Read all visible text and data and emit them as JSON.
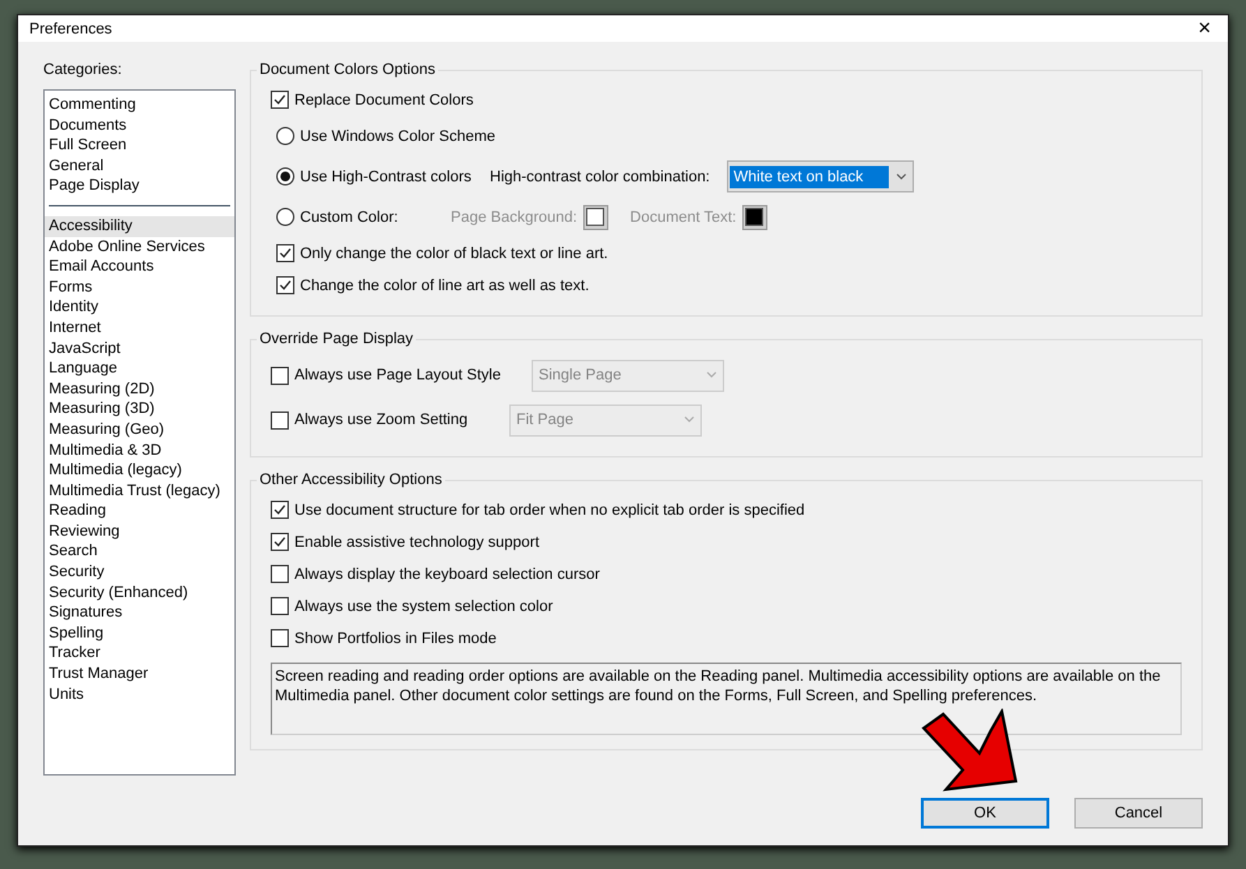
{
  "window": {
    "title": "Preferences",
    "close": "×"
  },
  "categories": {
    "label": "Categories:",
    "top_items": [
      {
        "label": "Commenting",
        "selected": false
      },
      {
        "label": "Documents",
        "selected": false
      },
      {
        "label": "Full Screen",
        "selected": false
      },
      {
        "label": "General",
        "selected": false
      },
      {
        "label": "Page Display",
        "selected": false
      }
    ],
    "items": [
      {
        "label": "Accessibility",
        "selected": true
      },
      {
        "label": "Adobe Online Services",
        "selected": false
      },
      {
        "label": "Email Accounts",
        "selected": false
      },
      {
        "label": "Forms",
        "selected": false
      },
      {
        "label": "Identity",
        "selected": false
      },
      {
        "label": "Internet",
        "selected": false
      },
      {
        "label": "JavaScript",
        "selected": false
      },
      {
        "label": "Language",
        "selected": false
      },
      {
        "label": "Measuring (2D)",
        "selected": false
      },
      {
        "label": "Measuring (3D)",
        "selected": false
      },
      {
        "label": "Measuring (Geo)",
        "selected": false
      },
      {
        "label": "Multimedia & 3D",
        "selected": false
      },
      {
        "label": "Multimedia (legacy)",
        "selected": false
      },
      {
        "label": "Multimedia Trust (legacy)",
        "selected": false
      },
      {
        "label": "Reading",
        "selected": false
      },
      {
        "label": "Reviewing",
        "selected": false
      },
      {
        "label": "Search",
        "selected": false
      },
      {
        "label": "Security",
        "selected": false
      },
      {
        "label": "Security (Enhanced)",
        "selected": false
      },
      {
        "label": "Signatures",
        "selected": false
      },
      {
        "label": "Spelling",
        "selected": false
      },
      {
        "label": "Tracker",
        "selected": false
      },
      {
        "label": "Trust Manager",
        "selected": false
      },
      {
        "label": "Units",
        "selected": false
      }
    ]
  },
  "document_colors": {
    "title": "Document Colors Options",
    "replace": {
      "label": "Replace Document Colors",
      "checked": true
    },
    "radios": [
      {
        "label": "Use Windows Color Scheme",
        "selected": false
      },
      {
        "label": "Use High-Contrast colors",
        "selected": true,
        "extra_label": "High-contrast color combination:",
        "dropdown": {
          "value": "White text on black",
          "focused": true
        }
      },
      {
        "label": "Custom Color:",
        "selected": false,
        "swatches": [
          {
            "label": "Page Background:",
            "color": "#ffffff"
          },
          {
            "label": "Document Text:",
            "color": "#000000"
          }
        ]
      }
    ],
    "checks": [
      {
        "label": "Only change the color of black text or line art.",
        "checked": true
      },
      {
        "label": "Change the color of line art as well as text.",
        "checked": true
      }
    ]
  },
  "override_page_display": {
    "title": "Override Page Display",
    "rows": [
      {
        "label": "Always use Page Layout Style",
        "checked": false,
        "dropdown": {
          "value": "Single Page",
          "disabled": true
        }
      },
      {
        "label": "Always use Zoom Setting",
        "checked": false,
        "dropdown": {
          "value": "Fit Page",
          "disabled": true
        }
      }
    ]
  },
  "other_accessibility": {
    "title": "Other Accessibility Options",
    "checks": [
      {
        "label": "Use document structure for tab order when no explicit tab order is specified",
        "checked": true
      },
      {
        "label": "Enable assistive technology support",
        "checked": true
      },
      {
        "label": "Always display the keyboard selection cursor",
        "checked": false
      },
      {
        "label": "Always use the system selection color",
        "checked": false
      },
      {
        "label": "Show Portfolios in Files mode",
        "checked": false
      }
    ],
    "note": "Screen reading and reading order options are available on the Reading panel. Multimedia accessibility options are available on the Multimedia panel. Other document color settings are found on the Forms, Full Screen, and Spelling preferences."
  },
  "buttons": [
    {
      "label": "OK",
      "default": true
    },
    {
      "label": "Cancel",
      "default": false
    }
  ]
}
